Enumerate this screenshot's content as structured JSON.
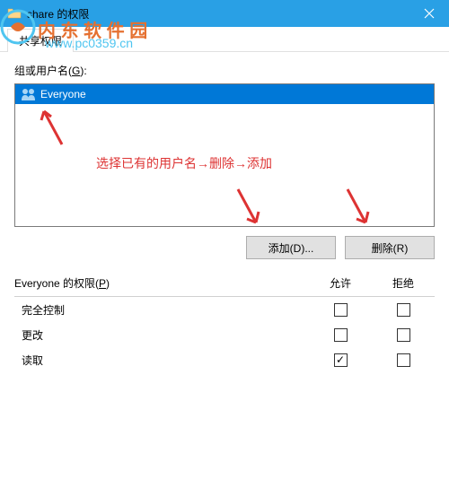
{
  "titlebar": {
    "title": "share 的权限"
  },
  "watermark": {
    "text": "内 东 软 件 园",
    "url": "www.pc0359.cn"
  },
  "tab": {
    "label": "共享权限"
  },
  "group_label_prefix": "组或用户名(",
  "group_label_key": "G",
  "group_label_suffix": "):",
  "list": {
    "items": [
      {
        "name": "Everyone"
      }
    ]
  },
  "annotation": "选择已有的用户名→删除→添加",
  "buttons": {
    "add": "添加(D)...",
    "remove": "删除(R)"
  },
  "perm_label_prefix": "Everyone 的权限(",
  "perm_label_key": "P",
  "perm_label_suffix": ")",
  "perm_headers": {
    "allow": "允许",
    "deny": "拒绝"
  },
  "permissions": [
    {
      "name": "完全控制",
      "allow": false,
      "deny": false
    },
    {
      "name": "更改",
      "allow": false,
      "deny": false
    },
    {
      "name": "读取",
      "allow": true,
      "deny": false
    }
  ]
}
